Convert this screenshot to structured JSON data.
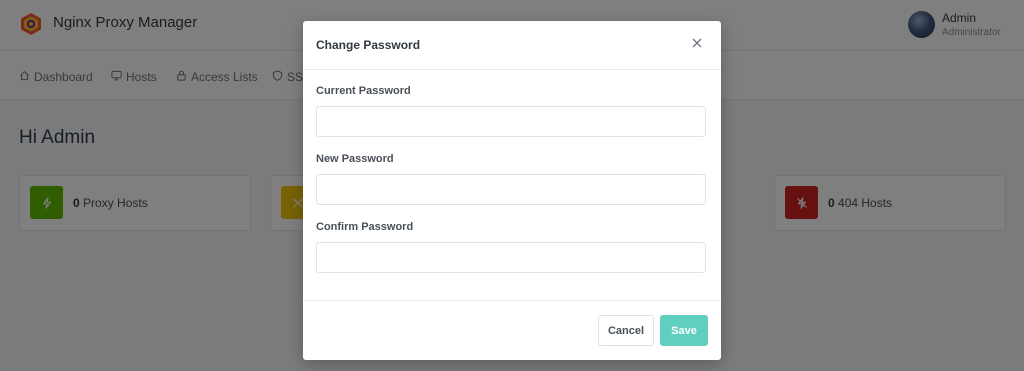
{
  "app": {
    "title": "Nginx Proxy Manager"
  },
  "user": {
    "name": "Admin",
    "role": "Administrator"
  },
  "nav": {
    "items": [
      {
        "label": "Dashboard",
        "icon": "home-icon"
      },
      {
        "label": "Hosts",
        "icon": "monitor-icon"
      },
      {
        "label": "Access Lists",
        "icon": "lock-icon"
      },
      {
        "label": "SSL",
        "icon": "shield-icon"
      }
    ]
  },
  "page": {
    "title": "Hi Admin"
  },
  "cards": [
    {
      "count": "0",
      "label": "Proxy Hosts",
      "color": "#5eba00",
      "icon": "zap-icon"
    },
    {
      "count": "",
      "label": "",
      "color": "#f1c40f",
      "icon": "shuffle-icon"
    },
    {
      "count": "0",
      "label": "404 Hosts",
      "color": "#cd201f",
      "icon": "zap-off-icon"
    }
  ],
  "modal": {
    "title": "Change Password",
    "fields": [
      {
        "label": "Current Password",
        "value": ""
      },
      {
        "label": "New Password",
        "value": ""
      },
      {
        "label": "Confirm Password",
        "value": ""
      }
    ],
    "cancel_label": "Cancel",
    "save_label": "Save"
  },
  "colors": {
    "accent": "#5fd0c0",
    "overlay": "rgba(0,0,0,0.5)"
  }
}
